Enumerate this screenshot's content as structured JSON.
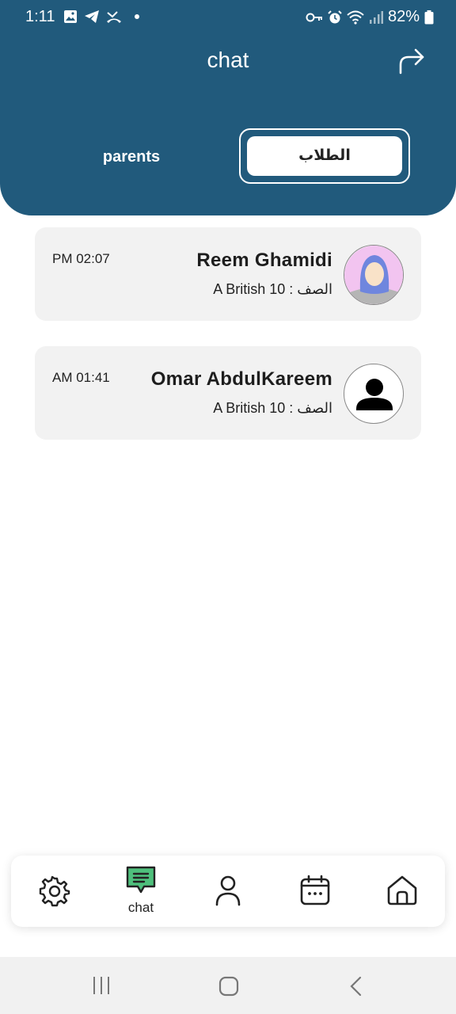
{
  "status_bar": {
    "time": "1:11",
    "battery": "82%"
  },
  "header": {
    "title": "chat",
    "tabs": {
      "parents": "parents",
      "students": "الطلاب"
    },
    "color": "#215a7c"
  },
  "chats": [
    {
      "name": "Reem Ghamidi",
      "class": "الصف : 10 A British",
      "time": "PM 02:07",
      "avatar": "female-avatar-icon"
    },
    {
      "name": "Omar AbdulKareem",
      "class": "الصف : 10 A British",
      "time": "AM 01:41",
      "avatar": "person-icon"
    }
  ],
  "bottom_nav": {
    "items": [
      {
        "icon": "gear-icon",
        "label": ""
      },
      {
        "icon": "chat-icon",
        "label": "chat",
        "active": true,
        "active_color": "#4ec07c"
      },
      {
        "icon": "user-icon",
        "label": ""
      },
      {
        "icon": "calendar-icon",
        "label": ""
      },
      {
        "icon": "home-icon",
        "label": ""
      }
    ]
  }
}
